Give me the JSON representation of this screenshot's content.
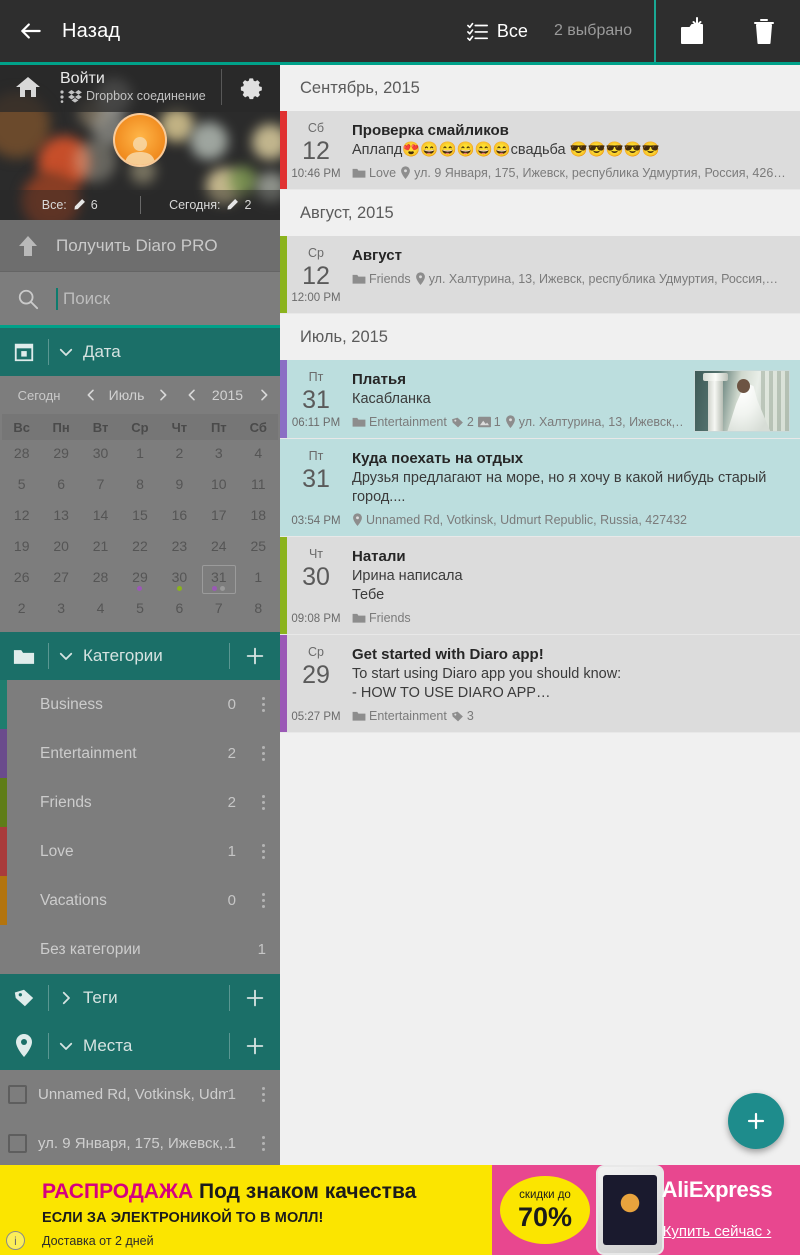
{
  "toolbar": {
    "back_label": "Назад",
    "back_icon": "arrow-left-icon",
    "select_all_label": "Все",
    "select_all_icon": "checklist-icon",
    "selected_count_label": "2 выбрано",
    "archive_icon": "folder-download-icon",
    "delete_icon": "trash-icon",
    "accent_color": "#00a189",
    "background_color": "#2e2e2e"
  },
  "sidebar": {
    "drawer": {
      "home_icon": "home-icon",
      "login_label": "Войти",
      "dropbox_label": "Dropbox соединение",
      "dropbox_icon": "dropbox-icon",
      "settings_icon": "gear-icon",
      "avatar_icon": "avatar-icon",
      "stats": [
        {
          "label": "Все:",
          "icon": "pencil-icon",
          "value": "6"
        },
        {
          "label": "Сегодня:",
          "icon": "pencil-icon",
          "value": "2"
        }
      ]
    },
    "pro": {
      "label": "Получить Diaro PRO",
      "icon": "arrow-up-icon"
    },
    "search": {
      "placeholder": "Поиск",
      "value": "",
      "icon": "search-icon"
    },
    "date_section": {
      "title": "Дата",
      "icon": "calendar-icon",
      "chevron": "chevron-down-icon",
      "expanded": true
    },
    "calendar": {
      "today_label": "Сегодн",
      "month": "Июль",
      "year": "2015",
      "prev_icon": "chevron-left-icon",
      "next_icon": "chevron-right-icon",
      "weekdays": [
        "Вс",
        "Пн",
        "Вт",
        "Ср",
        "Чт",
        "Пт",
        "Сб"
      ],
      "weeks": [
        [
          {
            "d": "28",
            "dim": true
          },
          {
            "d": "29",
            "dim": true
          },
          {
            "d": "30",
            "dim": true
          },
          {
            "d": "1"
          },
          {
            "d": "2"
          },
          {
            "d": "3"
          },
          {
            "d": "4"
          }
        ],
        [
          {
            "d": "5"
          },
          {
            "d": "6"
          },
          {
            "d": "7"
          },
          {
            "d": "8"
          },
          {
            "d": "9"
          },
          {
            "d": "10"
          },
          {
            "d": "11"
          }
        ],
        [
          {
            "d": "12"
          },
          {
            "d": "13"
          },
          {
            "d": "14"
          },
          {
            "d": "15"
          },
          {
            "d": "16"
          },
          {
            "d": "17"
          },
          {
            "d": "18"
          }
        ],
        [
          {
            "d": "19"
          },
          {
            "d": "20"
          },
          {
            "d": "21"
          },
          {
            "d": "22"
          },
          {
            "d": "23"
          },
          {
            "d": "24"
          },
          {
            "d": "25"
          }
        ],
        [
          {
            "d": "26"
          },
          {
            "d": "27"
          },
          {
            "d": "28"
          },
          {
            "d": "29",
            "dots": [
              "#9b59b6"
            ]
          },
          {
            "d": "30",
            "dots": [
              "#8bb31d"
            ]
          },
          {
            "d": "31",
            "selected": true,
            "dots": [
              "#9b59b6",
              "#9a9a9a"
            ]
          },
          {
            "d": "1",
            "dim": true
          }
        ],
        [
          {
            "d": "2",
            "dim": true
          },
          {
            "d": "3",
            "dim": true
          },
          {
            "d": "4",
            "dim": true
          },
          {
            "d": "5",
            "dim": true
          },
          {
            "d": "6",
            "dim": true
          },
          {
            "d": "7",
            "dim": true
          },
          {
            "d": "8",
            "dim": true
          }
        ]
      ]
    },
    "categories_section": {
      "title": "Категории",
      "icon": "folder-icon",
      "chevron": "chevron-down-icon",
      "add_icon": "plus-icon",
      "expanded": true
    },
    "categories": [
      {
        "name": "Business",
        "count": "0",
        "color": "#1e7d6e"
      },
      {
        "name": "Entertainment",
        "count": "2",
        "color": "#6a4b8c"
      },
      {
        "name": "Friends",
        "count": "2",
        "color": "#5f7d18"
      },
      {
        "name": "Love",
        "count": "1",
        "color": "#a93b3b"
      },
      {
        "name": "Vacations",
        "count": "0",
        "color": "#b3740e"
      },
      {
        "name": "Без категории",
        "count": "1",
        "color": "transparent"
      }
    ],
    "tags_section": {
      "title": "Теги",
      "icon": "tag-icon",
      "chevron": "chevron-right-icon",
      "add_icon": "plus-icon",
      "expanded": false
    },
    "places_section": {
      "title": "Места",
      "icon": "location-pin-icon",
      "chevron": "chevron-down-icon",
      "add_icon": "plus-icon",
      "expanded": true
    },
    "places": [
      {
        "name": "Unnamed Rd, Votkinsk, Udmu…",
        "count": "1",
        "checked": false
      },
      {
        "name": "ул. 9 Января, 175, Ижевск,…",
        "count": "1",
        "checked": false
      }
    ]
  },
  "entries": {
    "groups": [
      {
        "month_label": "Сентябрь, 2015",
        "items": [
          {
            "dow": "Сб",
            "day": "12",
            "time": "10:46 PM",
            "title": "Проверка смайликов",
            "text": "Аплапд😍😄😄😄😄😄свадьба 😎😎😎😎😎",
            "category": "Love",
            "location": "ул. 9 Января, 175, Ижевск, республика Удмуртия, Россия, 426…",
            "tags_count": "",
            "photos_count": "",
            "strip_color": "#e03131",
            "selected": false,
            "has_thumb": false
          }
        ]
      },
      {
        "month_label": "Август, 2015",
        "items": [
          {
            "dow": "Ср",
            "day": "12",
            "time": "12:00 PM",
            "title": "Август",
            "text": "",
            "category": "Friends",
            "location": "ул. Халтурина, 13, Ижевск, республика Удмуртия, Россия,…",
            "tags_count": "",
            "photos_count": "",
            "strip_color": "#8bb31d",
            "selected": false,
            "has_thumb": false
          }
        ]
      },
      {
        "month_label": "Июль, 2015",
        "items": [
          {
            "dow": "Пт",
            "day": "31",
            "time": "06:11 PM",
            "title": "Платья",
            "text": "Касабланка",
            "category": "Entertainment",
            "location": "ул. Халтурина, 13, Ижевск,…",
            "tags_count": "2",
            "photos_count": "1",
            "strip_color": "#8b6fc4",
            "selected": true,
            "has_thumb": true
          },
          {
            "dow": "Пт",
            "day": "31",
            "time": "03:54 PM",
            "title": "Куда поехать на отдых",
            "text": "Друзья предлагают на море, но я хочу в какой нибудь старый город....",
            "category": "",
            "location": "Unnamed Rd, Votkinsk, Udmurt Republic, Russia, 427432",
            "tags_count": "",
            "photos_count": "",
            "strip_color": "transparent",
            "selected": true,
            "has_thumb": false
          },
          {
            "dow": "Чт",
            "day": "30",
            "time": "09:08 PM",
            "title": "Натали",
            "text": "Ирина написала\nТебе",
            "category": "Friends",
            "location": "",
            "tags_count": "",
            "photos_count": "",
            "strip_color": "#8bb31d",
            "selected": false,
            "has_thumb": false
          },
          {
            "dow": "Ср",
            "day": "29",
            "time": "05:27 PM",
            "title": "Get started with Diaro app!",
            "text": "To start using Diaro app you should know:\n- HOW TO USE DIARO APP…",
            "category": "Entertainment",
            "location": "",
            "tags_count": "3",
            "photos_count": "",
            "strip_color": "#9b59b6",
            "selected": false,
            "has_thumb": false
          }
        ]
      }
    ]
  },
  "fab": {
    "icon": "plus-icon",
    "color": "#1e8c8c"
  },
  "ad": {
    "headline_highlight": "РАСПРОДАЖА",
    "headline_rest": "Под знаком качества",
    "subline": "ЕСЛИ ЗА ЭЛЕКТРОНИКОЙ ТО В МОЛЛ!",
    "delivery": "Доставка от 2 дней",
    "info_icon": "info-icon",
    "badge_top": "скидки до",
    "badge_value": "70%",
    "brand": "AliExpress",
    "cta": "Купить сейчас ›",
    "yellow": "#fbe500",
    "pink": "#e8478f"
  }
}
